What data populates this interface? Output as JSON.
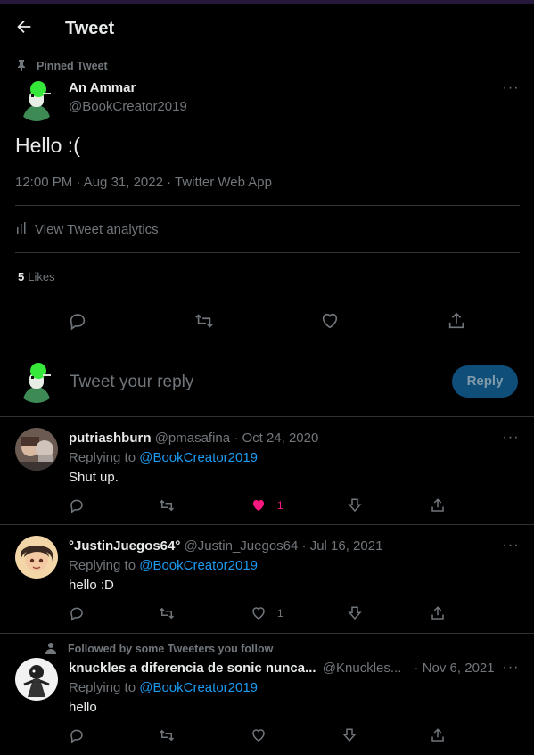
{
  "header": {
    "title": "Tweet"
  },
  "pinned_label": "Pinned Tweet",
  "main_tweet": {
    "name": "An Ammar",
    "handle": "@BookCreator2019",
    "text": "Hello :(",
    "meta": "12:00 PM · Aug 31, 2022 · Twitter Web App",
    "analytics_label": "View Tweet analytics",
    "likes_count": "5",
    "likes_label": "Likes"
  },
  "compose": {
    "placeholder": "Tweet your reply",
    "button": "Reply"
  },
  "replies": [
    {
      "name": "putriashburn",
      "handle": "@pmasafina",
      "date": "· Oct 24, 2020",
      "replying_prefix": "Replying to",
      "replying_to": "@BookCreator2019",
      "text": "Shut up.",
      "like_count": "1",
      "liked": true
    },
    {
      "name": "°JustinJuegos64°",
      "handle": "@Justin_Juegos64",
      "date": "· Jul 16, 2021",
      "replying_prefix": "Replying to",
      "replying_to": "@BookCreator2019",
      "text": "hello :D",
      "like_count": "1",
      "liked": false
    },
    {
      "social_context": "Followed by some Tweeters you follow",
      "name": "knuckles a diferencia de sonic nunca...",
      "handle": "@Knuckles...",
      "date": "· Nov 6, 2021",
      "replying_prefix": "Replying to",
      "replying_to": "@BookCreator2019",
      "text": "hello",
      "like_count": "",
      "liked": false
    }
  ],
  "colors": {
    "accent": "#1d9bf0",
    "like": "#f91880",
    "reply_button": "#0f4e78",
    "background": "#000000"
  }
}
